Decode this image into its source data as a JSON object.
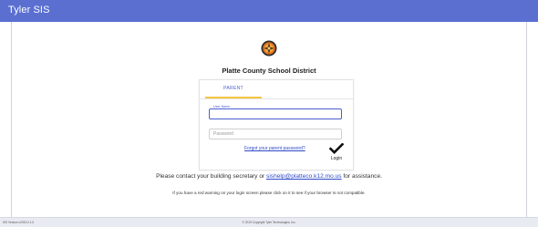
{
  "header": {
    "brand": "Tyler SIS",
    "background": "#5a6fd0"
  },
  "district": {
    "logo_icon": "district-seal-icon",
    "name": "Platte County School District"
  },
  "login": {
    "tabs": [
      {
        "label": "PARENT",
        "active": true
      }
    ],
    "username": {
      "label": "User Name",
      "value": ""
    },
    "password": {
      "placeholder": "Password",
      "value": ""
    },
    "forgot_link": "Forgot your parent password?",
    "login_icon": "checkmark-icon",
    "login_label": "Login"
  },
  "help": {
    "contact_prefix": "Please contact your building secretary or ",
    "contact_email": "sishelp@platteco.k12.mo.us",
    "contact_suffix": " for assistance.",
    "warning": "If you have a red warning on your login screen please click on it to see if your browser is not compatible."
  },
  "footer": {
    "version": "SIS Version v2019.2.1.0",
    "copyright": "© 2019 Copyright Tyler Technologies, Inc."
  },
  "colors": {
    "accent": "#4a5fcf",
    "tab_underline": "#f4c542",
    "link": "#2f4ac8",
    "footer_bg": "#e9ebf3"
  }
}
